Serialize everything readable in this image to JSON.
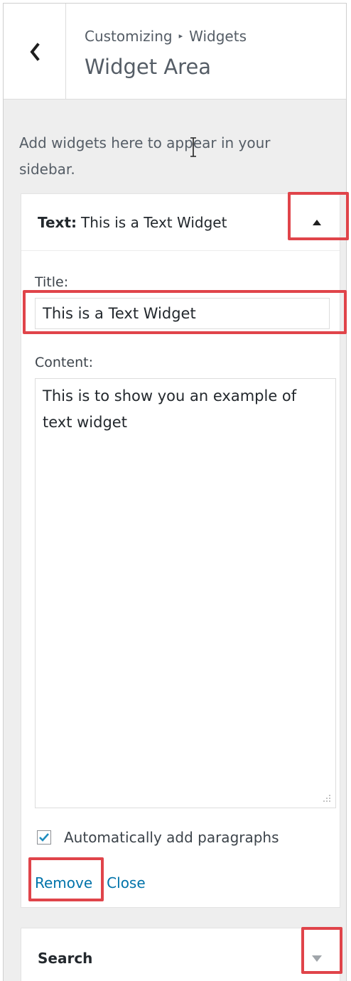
{
  "header": {
    "back_icon": "chevron-left-icon",
    "breadcrumb": {
      "parent": "Customizing",
      "separator": "▸",
      "current": "Widgets"
    },
    "title": "Widget Area"
  },
  "description": "Add widgets here to appear in your sidebar.",
  "text_widget": {
    "type_label": "Text:",
    "title_text": "This is a Text Widget",
    "toggle_icon": "arrow-up-icon",
    "fields": {
      "title_label": "Title:",
      "title_value": "This is a Text Widget",
      "content_label": "Content:",
      "content_value": "This is to show you an example of text widget"
    },
    "auto_paragraphs": {
      "label": "Automatically add paragraphs",
      "checked": true
    },
    "actions": {
      "remove": "Remove",
      "close": "Close"
    }
  },
  "search_widget": {
    "title": "Search",
    "toggle_icon": "arrow-down-icon"
  },
  "colors": {
    "panel_bg": "#eeeeee",
    "link": "#0073aa",
    "highlight": "#e0444a",
    "text": "#23282d"
  }
}
